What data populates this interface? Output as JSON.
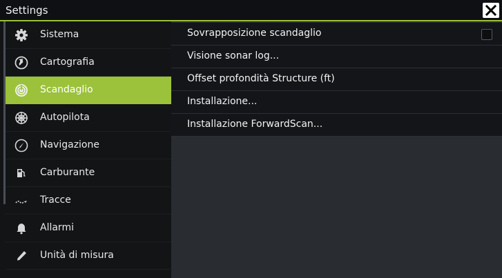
{
  "window": {
    "title": "Settings",
    "close_icon": "close-icon"
  },
  "sidebar": {
    "items": [
      {
        "label": "Sistema",
        "icon": "gear-icon",
        "active": false
      },
      {
        "label": "Cartografia",
        "icon": "globe-icon",
        "active": false
      },
      {
        "label": "Scandaglio",
        "icon": "sonar-icon",
        "active": true
      },
      {
        "label": "Autopilota",
        "icon": "ship-wheel-icon",
        "active": false
      },
      {
        "label": "Navigazione",
        "icon": "compass-icon",
        "active": false
      },
      {
        "label": "Carburante",
        "icon": "fuel-pump-icon",
        "active": false
      },
      {
        "label": "Tracce",
        "icon": "track-icon",
        "active": false
      },
      {
        "label": "Allarmi",
        "icon": "bell-icon",
        "active": false
      },
      {
        "label": "Unità di misura",
        "icon": "pencil-icon",
        "active": false
      }
    ]
  },
  "content": {
    "rows": [
      {
        "label": "Sovrapposizione scandaglio",
        "has_checkbox": true,
        "checked": false
      },
      {
        "label": "Visione sonar log..."
      },
      {
        "label": "Offset profondità Structure (ft)"
      },
      {
        "label": "Installazione..."
      },
      {
        "label": "Installazione ForwardScan..."
      }
    ]
  },
  "colors": {
    "accent": "#9bc23a",
    "titlebar": "#0e1013",
    "sidebar_bg": "#121416",
    "content_bg": "#292d32",
    "row_bg": "#131519"
  }
}
